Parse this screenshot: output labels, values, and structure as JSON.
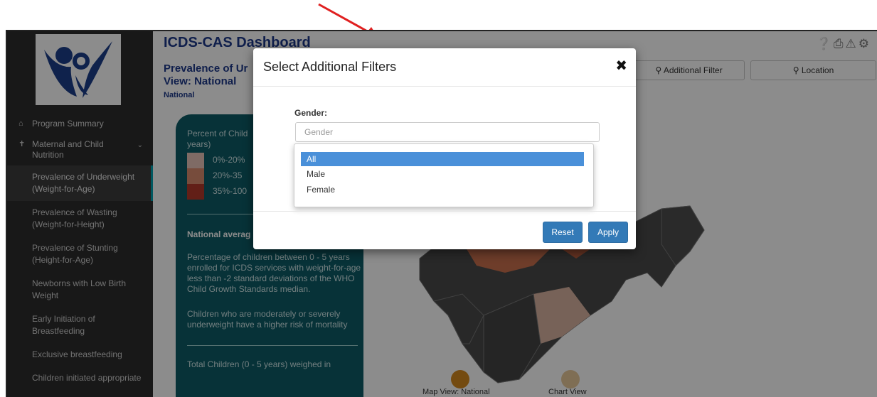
{
  "sidebar": {
    "items": [
      {
        "label": "Program Summary",
        "icon": "home-icon"
      },
      {
        "label": "Maternal and Child Nutrition",
        "icon": "child-icon"
      }
    ],
    "subitems": [
      "Prevalence of Underweight (Weight-for-Age)",
      "Prevalence of Wasting (Weight-for-Height)",
      "Prevalence of Stunting (Height-for-Age)",
      "Newborns with Low Birth Weight",
      "Early Initiation of Breastfeeding",
      "Exclusive breastfeeding",
      "Children initiated appropriate"
    ],
    "active_index": 0
  },
  "header": {
    "title": "ICDS-CAS Dashboard",
    "subtitle_line1": "Prevalence of Ur",
    "subtitle_line2": "View: National",
    "breadcrumb": "National",
    "icons": [
      "help-icon",
      "print-icon",
      "warning-icon",
      "gear-icon"
    ]
  },
  "filters": {
    "additional": "Additional Filter",
    "location": "Location"
  },
  "panel": {
    "legend_title_line1": "Percent of Child",
    "legend_title_line2": "years)",
    "legend": [
      {
        "label": "0%-20%",
        "color": "#e8c4b8"
      },
      {
        "label": "20%-35",
        "color": "#d98a6e"
      },
      {
        "label": "35%-100",
        "color": "#b23a2a"
      }
    ],
    "national_average": "National averag",
    "description": "Percentage of children between 0 - 5 years enrolled for ICDS services with weight-for-age less than -2 standard deviations of the WHO Child Growth Standards median.",
    "description2": "Children who are moderately or severely underweight have a higher risk of mortality",
    "total": "Total Children (0 - 5 years) weighed in"
  },
  "views": {
    "map": "Map View: National",
    "chart": "Chart View",
    "map_color": "#d4891e",
    "chart_color": "#e8c89a"
  },
  "modal": {
    "title": "Select Additional Filters",
    "gender_label": "Gender:",
    "gender_placeholder": "Gender",
    "options": [
      "All",
      "Male",
      "Female"
    ],
    "selected": "All",
    "reset": "Reset",
    "apply": "Apply"
  }
}
